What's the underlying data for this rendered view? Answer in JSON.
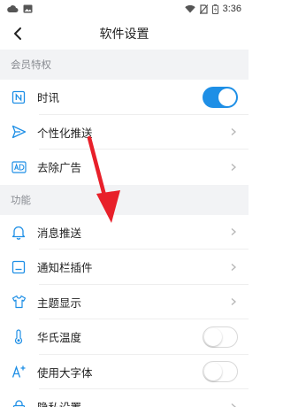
{
  "status_bar": {
    "time": "3:36",
    "left_icons": [
      "cloud-icon",
      "image-icon"
    ],
    "right_icons": [
      "wifi-icon",
      "no-sim-icon",
      "battery-icon"
    ]
  },
  "header": {
    "title": "软件设置",
    "back_icon": "chevron-left-icon"
  },
  "sections": [
    {
      "title": "会员特权",
      "items": [
        {
          "label": "时讯",
          "icon": "news-icon",
          "control": "toggle",
          "toggle_on": true
        },
        {
          "label": "个性化推送",
          "icon": "send-icon",
          "control": "chevron"
        },
        {
          "label": "去除广告",
          "icon": "ad-icon",
          "control": "chevron"
        }
      ]
    },
    {
      "title": "功能",
      "items": [
        {
          "label": "消息推送",
          "icon": "bell-icon",
          "control": "chevron"
        },
        {
          "label": "通知栏插件",
          "icon": "notification-widget-icon",
          "control": "chevron"
        },
        {
          "label": "主题显示",
          "icon": "shirt-icon",
          "control": "chevron"
        },
        {
          "label": "华氏温度",
          "icon": "thermometer-icon",
          "control": "toggle",
          "toggle_on": false
        },
        {
          "label": "使用大字体",
          "icon": "font-size-icon",
          "control": "toggle",
          "toggle_on": false
        },
        {
          "label": "隐私设置",
          "icon": "lock-icon",
          "control": "chevron"
        }
      ]
    }
  ],
  "colors": {
    "accent": "#1e8fe6",
    "section_bg": "#f2f3f5",
    "annotation_arrow": "#e8202a"
  },
  "annotation": {
    "type": "red-arrow",
    "points_to": "消息推送"
  }
}
